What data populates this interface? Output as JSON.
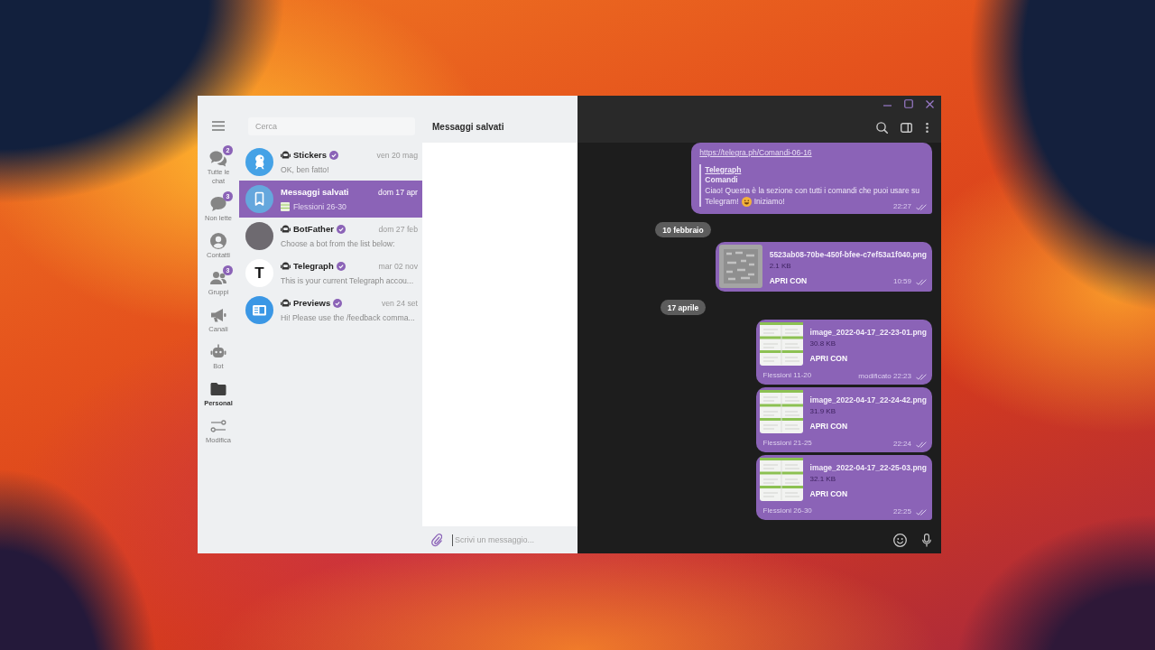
{
  "folders": {
    "items": [
      {
        "label": "Tutte le chat",
        "kind": "all",
        "badge": "2",
        "selected": false
      },
      {
        "label": "Non lette",
        "kind": "unread",
        "badge": "3",
        "selected": false
      },
      {
        "label": "Contatti",
        "kind": "contacts",
        "selected": false
      },
      {
        "label": "Gruppi",
        "kind": "groups",
        "badge": "3",
        "selected": false
      },
      {
        "label": "Canali",
        "kind": "channels",
        "selected": false
      },
      {
        "label": "Bot",
        "kind": "bots",
        "selected": false
      },
      {
        "label": "Personal",
        "kind": "custom",
        "selected": true
      },
      {
        "label": "Modifica",
        "kind": "edit",
        "selected": false
      }
    ]
  },
  "chat_list": {
    "search": {
      "placeholder": "Cerca"
    },
    "chats": [
      {
        "name": "Stickers",
        "avatar": {
          "kind": "sticker"
        },
        "bot": true,
        "verified": true,
        "time": "ven 20 mag",
        "preview": "OK, ben fatto!",
        "attachment": false,
        "selected": false
      },
      {
        "name": "Messaggi salvati",
        "avatar": {
          "kind": "saved"
        },
        "bot": false,
        "verified": false,
        "time": "dom 17 apr",
        "preview": "Flessioni 26-30",
        "attachment": true,
        "selected": true
      },
      {
        "name": "BotFather",
        "avatar": {
          "kind": "photo"
        },
        "bot": true,
        "verified": true,
        "time": "dom 27 feb",
        "preview": "Choose a bot from the list below:",
        "attachment": false,
        "selected": false
      },
      {
        "name": "Telegraph",
        "avatar": {
          "kind": "letter",
          "letter": "T"
        },
        "bot": true,
        "verified": true,
        "time": "mar 02 nov",
        "preview": "This is your current Telegraph accou...",
        "attachment": false,
        "selected": false
      },
      {
        "name": "Previews",
        "avatar": {
          "kind": "news"
        },
        "bot": true,
        "verified": true,
        "time": "ven 24 set",
        "preview": "Hi! Please use the /feedback comma...",
        "attachment": false,
        "selected": false
      }
    ]
  },
  "chat_header": {
    "title": "Messaggi salvati"
  },
  "messages": [
    {
      "kind": "link",
      "url": "https://telegra.ph/Comandi-06-16",
      "site": "Telegraph",
      "title": "Comandi",
      "description_lines": [
        [
          "Ciao! Questa è la sezione con tutti i comandi che puoi usare su"
        ],
        [
          "Telegram!",
          "Iniziamo!"
        ]
      ],
      "time": "22:27",
      "read": true
    },
    {
      "kind": "date",
      "label": "10 febbraio"
    },
    {
      "kind": "file",
      "thumb": {
        "kind": "scan"
      },
      "name": "5523ab08-70be-450f-bfee-c7ef53a1f040.png",
      "size": "2.1 KB",
      "action": "APRI CON",
      "time": "10:59",
      "read": true
    },
    {
      "kind": "date",
      "label": "17 aprile"
    },
    {
      "kind": "file",
      "thumb": {
        "kind": "table"
      },
      "name": "image_2022-04-17_22-23-01.png",
      "size": "30.8 KB",
      "action": "APRI CON",
      "caption": "Flessioni 11-20",
      "time": "modificato 22:23",
      "read": true
    },
    {
      "kind": "file",
      "thumb": {
        "kind": "table"
      },
      "name": "image_2022-04-17_22-24-42.png",
      "size": "31.9 KB",
      "action": "APRI CON",
      "caption": "Flessioni 21-25",
      "time": "22:24",
      "read": true
    },
    {
      "kind": "file",
      "thumb": {
        "kind": "table"
      },
      "name": "image_2022-04-17_22-25-03.png",
      "size": "32.1 KB",
      "action": "APRI CON",
      "caption": "Flessioni 26-30",
      "time": "22:25",
      "read": true
    }
  ],
  "composer": {
    "placeholder": "Scrivi un messaggio..."
  }
}
